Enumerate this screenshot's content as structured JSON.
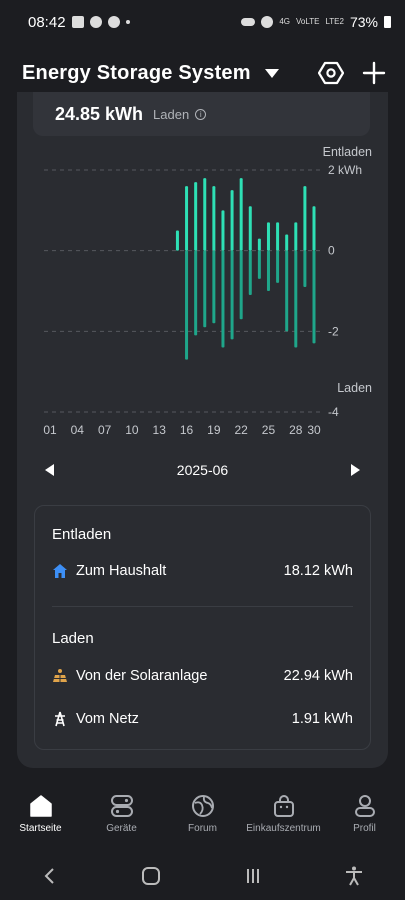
{
  "status": {
    "time": "08:42",
    "network_label": "4G",
    "sim_label": "LTE2",
    "volte_label": "VoLTE",
    "battery": "73%"
  },
  "header": {
    "title": "Energy Storage System"
  },
  "summary": {
    "energy": "24.85 kWh",
    "state": "Laden"
  },
  "chart_data": {
    "type": "bar",
    "title": "",
    "top_label": "Entladen",
    "bottom_label": "Laden",
    "y_unit_label": "2 kWh",
    "y_ticks": [
      "2 kWh",
      "0",
      "-2",
      "-4"
    ],
    "ylim": [
      -4,
      2
    ],
    "grid": true,
    "x_ticks": [
      "01",
      "04",
      "07",
      "10",
      "13",
      "16",
      "19",
      "22",
      "25",
      "28",
      "30"
    ],
    "days": [
      1,
      2,
      3,
      4,
      5,
      6,
      7,
      8,
      9,
      10,
      11,
      12,
      13,
      14,
      15,
      16,
      17,
      18,
      19,
      20,
      21,
      22,
      23,
      24,
      25,
      26,
      27,
      28,
      29,
      30
    ],
    "series": [
      {
        "name": "Entladen",
        "color": "#2ee0b5",
        "values": [
          0,
          0,
          0,
          0,
          0,
          0,
          0,
          0,
          0,
          0,
          0,
          0,
          0,
          0,
          0.5,
          1.6,
          1.7,
          1.8,
          1.6,
          1.0,
          1.5,
          1.8,
          1.1,
          0.3,
          0.7,
          0.7,
          0.4,
          0.7,
          1.6,
          1.1
        ]
      },
      {
        "name": "Laden",
        "color": "#1fa68a",
        "values": [
          0,
          0,
          0,
          0,
          0,
          0,
          0,
          0,
          0,
          0,
          0,
          0,
          0,
          0,
          0,
          -2.7,
          -2.1,
          -1.9,
          -1.8,
          -2.4,
          -2.2,
          -1.7,
          -1.1,
          -0.7,
          -1.0,
          -0.8,
          -2.0,
          -2.4,
          -0.9,
          -2.3
        ]
      }
    ]
  },
  "month_nav": {
    "month": "2025-06"
  },
  "breakdown": {
    "discharge_title": "Entladen",
    "household_label": "Zum Haushalt",
    "household_value": "18.12 kWh",
    "charge_title": "Laden",
    "solar_label": "Von der Solaranlage",
    "solar_value": "22.94 kWh",
    "grid_label": "Vom Netz",
    "grid_value": "1.91 kWh"
  },
  "tabs": [
    {
      "label": "Startseite",
      "icon": "home-icon",
      "active": true
    },
    {
      "label": "Geräte",
      "icon": "devices-icon",
      "active": false
    },
    {
      "label": "Forum",
      "icon": "forum-icon",
      "active": false
    },
    {
      "label": "Einkaufszentrum",
      "icon": "shop-icon",
      "active": false
    },
    {
      "label": "Profil",
      "icon": "profile-icon",
      "active": false
    }
  ],
  "colors": {
    "accent": "#2ee0b5",
    "background": "#1c1d21",
    "card": "#2a2c31",
    "household_icon": "#3d8ff5",
    "solar_icon": "#e0a44a"
  }
}
